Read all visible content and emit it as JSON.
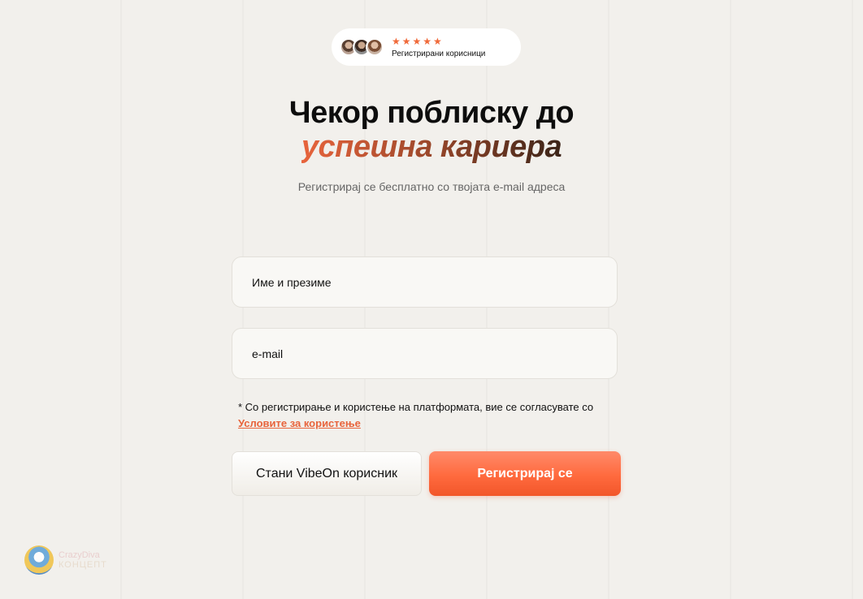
{
  "badge": {
    "stars": "★★★★★",
    "label": "Регистрирани корисници"
  },
  "hero": {
    "title_line1": "Чекор поблиску до",
    "title_line2": "успешна кариера",
    "subtitle": "Регистрирај се бесплатно со твојата e-mail адреса"
  },
  "form": {
    "name_placeholder": "Име и презиме",
    "email_placeholder": "e-mail",
    "terms_text": "* Со регистрирање и користење на платформата, вие се согласувате со",
    "terms_link": "Условите за користење"
  },
  "buttons": {
    "secondary": "Стани VibeOn корисник",
    "primary": "Регистрирај се"
  },
  "watermark": {
    "line1": "CrazyDiva",
    "line2": "КОНЦЕПТ"
  },
  "colors": {
    "accent": "#ff6a3e",
    "background": "#f2f0ec"
  }
}
